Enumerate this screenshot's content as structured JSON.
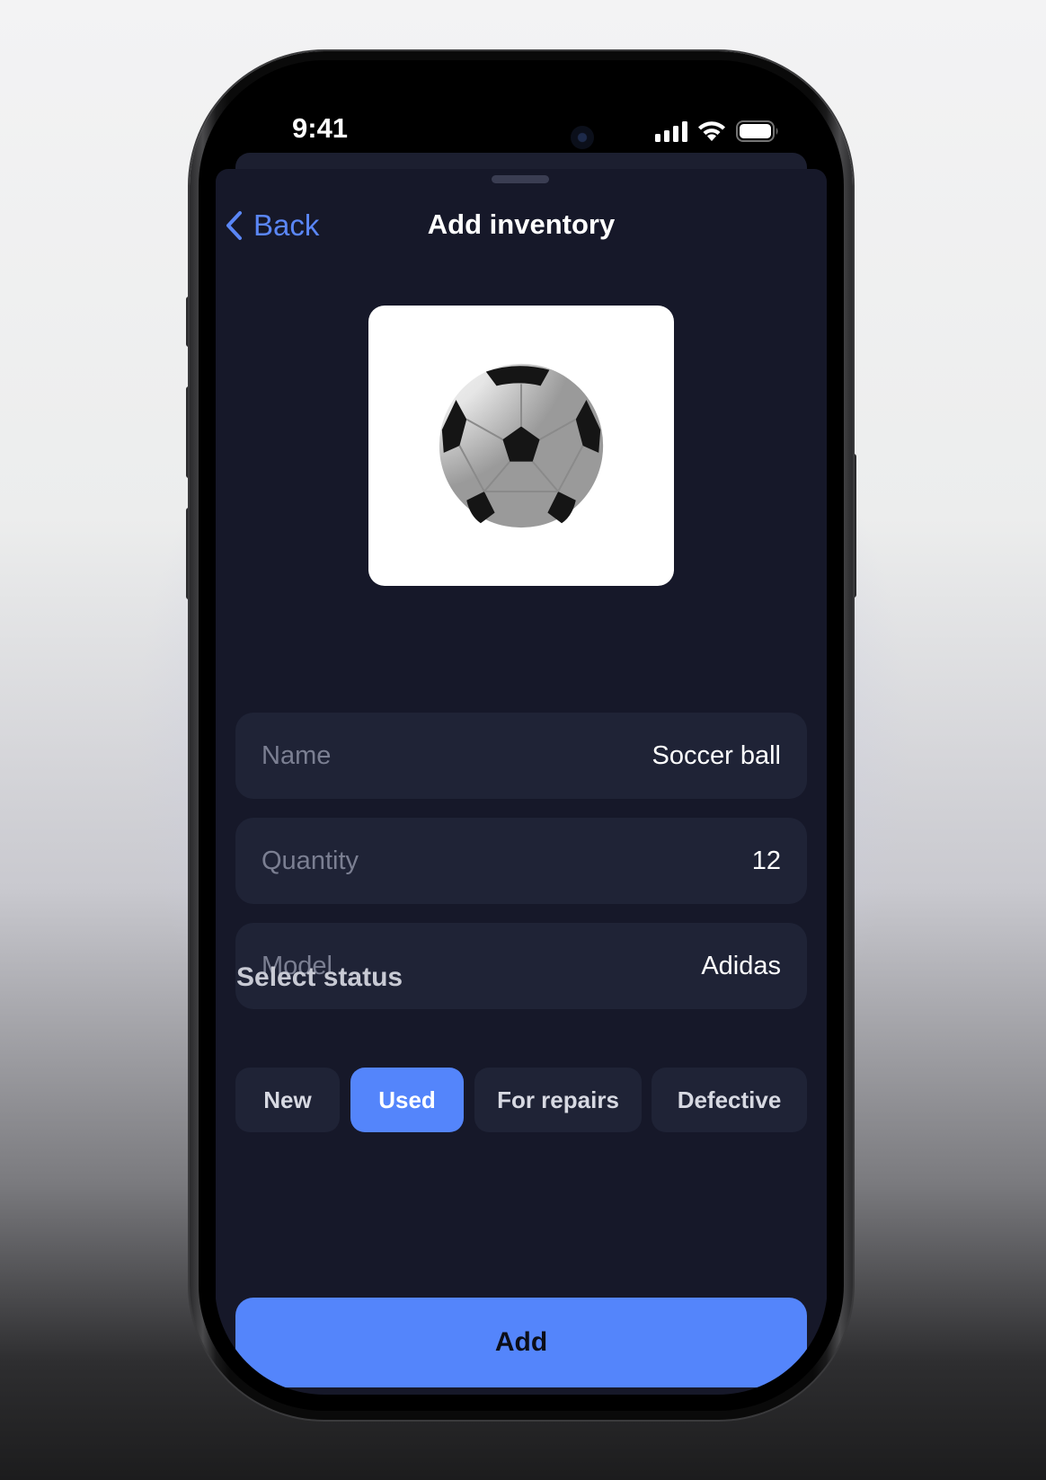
{
  "status_bar": {
    "time": "9:41"
  },
  "nav": {
    "back_label": "Back",
    "title": "Add inventory"
  },
  "photo": {
    "icon": "soccer-ball-image"
  },
  "fields": [
    {
      "label": "Name",
      "value": "Soccer ball"
    },
    {
      "label": "Quantity",
      "value": "12"
    },
    {
      "label": "Model",
      "value": "Adidas"
    }
  ],
  "status": {
    "label": "Select status",
    "options": [
      "New",
      "Used",
      "For repairs",
      "Defective"
    ],
    "selected": "Used"
  },
  "actions": {
    "add_label": "Add"
  },
  "colors": {
    "accent": "#5485fb",
    "background": "#161829",
    "field": "#1f2336"
  }
}
